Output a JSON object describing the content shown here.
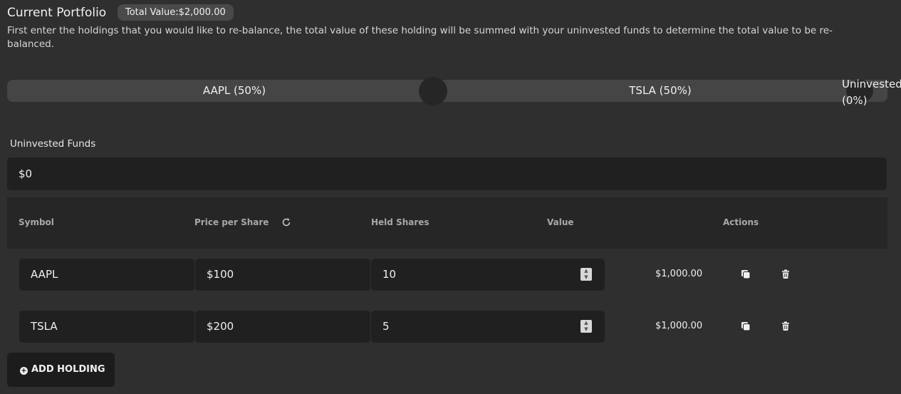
{
  "header": {
    "title": "Current Portfolio",
    "total_value_badge": "Total Value:$2,000.00",
    "description": "First enter the holdings that you would like to re-balance, the total value of these holding will be summed with your uninvested funds to determine the total value to be re-balanced."
  },
  "allocation_slider": {
    "segments": [
      {
        "label": "AAPL (50%)",
        "percent": 50
      },
      {
        "label": "TSLA (50%)",
        "percent": 50
      },
      {
        "label_line1": "Uninvested",
        "label_line2": "(0%)",
        "percent": 0
      }
    ]
  },
  "funds": {
    "label": "Uninvested Funds",
    "value": "$0"
  },
  "table": {
    "columns": [
      "Symbol",
      "Price per Share",
      "Held Shares",
      "Value",
      "Actions"
    ],
    "rows": [
      {
        "symbol": "AAPL",
        "price": "$100",
        "shares": "10",
        "value": "$1,000.00"
      },
      {
        "symbol": "TSLA",
        "price": "$200",
        "shares": "5",
        "value": "$1,000.00"
      }
    ]
  },
  "add_button": {
    "label": "ADD HOLDING"
  },
  "icons": [
    "refresh-icon",
    "copy-icon",
    "trash-icon",
    "plus-circle-icon"
  ]
}
